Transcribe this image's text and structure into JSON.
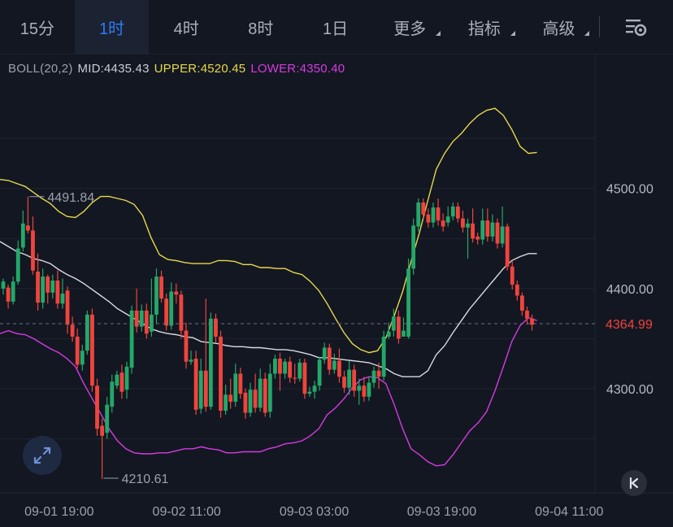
{
  "tabs": [
    {
      "label": "15分",
      "active": false,
      "caret": false
    },
    {
      "label": "1时",
      "active": true,
      "caret": false
    },
    {
      "label": "4时",
      "active": false,
      "caret": false
    },
    {
      "label": "8时",
      "active": false,
      "caret": false
    },
    {
      "label": "1日",
      "active": false,
      "caret": false
    },
    {
      "label": "更多",
      "active": false,
      "caret": true
    },
    {
      "label": "指标",
      "active": false,
      "caret": true
    },
    {
      "label": "高级",
      "active": false,
      "caret": true
    }
  ],
  "icons": {
    "settings": "chart-settings-icon",
    "zoom": "expand-arrows-icon",
    "reset": "scroll-to-latest-icon"
  },
  "legend": {
    "name": "BOLL(20,2)",
    "mid": "MID:4435.43",
    "upper": "UPPER:4520.45",
    "lower": "LOWER:4350.40"
  },
  "colors": {
    "up": "#24a869",
    "down": "#f0443d",
    "mid": "#d9dbe0",
    "upper": "#e7d94a",
    "lower": "#d63be0",
    "active_tab": "#2f7bf2"
  },
  "chart_data": {
    "type": "candlestick",
    "y_ticks": [
      "4500.00",
      "4400.00",
      "4300.00"
    ],
    "x_ticks": [
      "09-01 19:00",
      "09-02 11:00",
      "09-03 03:00",
      "09-03 19:00",
      "09-04 11:00"
    ],
    "current_price": "4364.99",
    "high_label": "4491.84",
    "low_label": "4210.61",
    "ylim": [
      4196,
      4607
    ],
    "candles": [
      [
        4400,
        4407,
        4394,
        4410
      ],
      [
        4401,
        4387,
        4380,
        4404
      ],
      [
        4387,
        4407,
        4384,
        4412
      ],
      [
        4407,
        4440,
        4404,
        4448
      ],
      [
        4441,
        4465,
        4437,
        4478
      ],
      [
        4463,
        4458,
        4455,
        4492
      ],
      [
        4458,
        4418,
        4414,
        4472
      ],
      [
        4417,
        4386,
        4378,
        4435
      ],
      [
        4386,
        4412,
        4380,
        4420
      ],
      [
        4412,
        4396,
        4385,
        4414
      ],
      [
        4396,
        4408,
        4390,
        4414
      ],
      [
        4408,
        4385,
        4380,
        4418
      ],
      [
        4385,
        4395,
        4380,
        4410
      ],
      [
        4398,
        4364,
        4355,
        4402
      ],
      [
        4364,
        4352,
        4347,
        4372
      ],
      [
        4352,
        4324,
        4320,
        4360
      ],
      [
        4324,
        4338,
        4318,
        4344
      ],
      [
        4338,
        4374,
        4334,
        4378
      ],
      [
        4374,
        4303,
        4297,
        4380
      ],
      [
        4303,
        4260,
        4253,
        4310
      ],
      [
        4263,
        4253,
        4210,
        4270
      ],
      [
        4256,
        4284,
        4250,
        4292
      ],
      [
        4282,
        4307,
        4276,
        4314
      ],
      [
        4303,
        4314,
        4300,
        4318
      ],
      [
        4316,
        4297,
        4290,
        4324
      ],
      [
        4299,
        4322,
        4290,
        4327
      ],
      [
        4321,
        4378,
        4315,
        4383
      ],
      [
        4378,
        4362,
        4356,
        4400
      ],
      [
        4362,
        4378,
        4357,
        4384
      ],
      [
        4378,
        4355,
        4350,
        4385
      ],
      [
        4357,
        4374,
        4352,
        4410
      ],
      [
        4374,
        4412,
        4365,
        4420
      ],
      [
        4412,
        4390,
        4386,
        4418
      ],
      [
        4390,
        4363,
        4358,
        4395
      ],
      [
        4363,
        4397,
        4359,
        4406
      ],
      [
        4397,
        4394,
        4385,
        4405
      ],
      [
        4394,
        4358,
        4350,
        4398
      ],
      [
        4358,
        4327,
        4320,
        4366
      ],
      [
        4327,
        4329,
        4324,
        4338
      ],
      [
        4330,
        4279,
        4274,
        4338
      ],
      [
        4280,
        4318,
        4275,
        4330
      ],
      [
        4318,
        4282,
        4277,
        4390
      ],
      [
        4282,
        4370,
        4279,
        4376
      ],
      [
        4370,
        4352,
        4346,
        4375
      ],
      [
        4352,
        4278,
        4271,
        4358
      ],
      [
        4278,
        4294,
        4274,
        4304
      ],
      [
        4294,
        4287,
        4280,
        4310
      ],
      [
        4287,
        4315,
        4282,
        4325
      ],
      [
        4315,
        4295,
        4290,
        4321
      ],
      [
        4296,
        4276,
        4270,
        4300
      ],
      [
        4276,
        4299,
        4272,
        4306
      ],
      [
        4299,
        4281,
        4276,
        4315
      ],
      [
        4281,
        4310,
        4277,
        4320
      ],
      [
        4310,
        4276,
        4272,
        4316
      ],
      [
        4277,
        4315,
        4271,
        4325
      ],
      [
        4315,
        4330,
        4310,
        4334
      ],
      [
        4330,
        4315,
        4298,
        4336
      ],
      [
        4315,
        4327,
        4310,
        4330
      ],
      [
        4327,
        4311,
        4306,
        4332
      ],
      [
        4311,
        4310,
        4305,
        4325
      ],
      [
        4310,
        4326,
        4307,
        4330
      ],
      [
        4326,
        4295,
        4290,
        4330
      ],
      [
        4295,
        4297,
        4292,
        4302
      ],
      [
        4297,
        4303,
        4290,
        4308
      ],
      [
        4303,
        4329,
        4298,
        4332
      ],
      [
        4329,
        4341,
        4325,
        4346
      ],
      [
        4341,
        4319,
        4314,
        4345
      ],
      [
        4319,
        4328,
        4315,
        4335
      ],
      [
        4328,
        4312,
        4306,
        4340
      ],
      [
        4312,
        4301,
        4296,
        4318
      ],
      [
        4301,
        4319,
        4294,
        4328
      ],
      [
        4319,
        4298,
        4292,
        4324
      ],
      [
        4298,
        4303,
        4284,
        4310
      ],
      [
        4303,
        4292,
        4287,
        4312
      ],
      [
        4292,
        4306,
        4288,
        4312
      ],
      [
        4306,
        4318,
        4301,
        4322
      ],
      [
        4318,
        4312,
        4300,
        4326
      ],
      [
        4312,
        4352,
        4308,
        4358
      ],
      [
        4352,
        4357,
        4350,
        4366
      ],
      [
        4358,
        4372,
        4352,
        4380
      ],
      [
        4372,
        4350,
        4345,
        4378
      ],
      [
        4352,
        4358,
        4355,
        4371
      ],
      [
        4352,
        4420,
        4350,
        4430
      ],
      [
        4420,
        4463,
        4414,
        4470
      ],
      [
        4462,
        4486,
        4457,
        4490
      ],
      [
        4486,
        4474,
        4470,
        4490
      ],
      [
        4474,
        4466,
        4461,
        4480
      ],
      [
        4466,
        4481,
        4461,
        4486
      ],
      [
        4481,
        4468,
        4463,
        4490
      ],
      [
        4468,
        4462,
        4457,
        4475
      ],
      [
        4466,
        4472,
        4462,
        4482
      ],
      [
        4472,
        4482,
        4468,
        4486
      ],
      [
        4482,
        4470,
        4466,
        4486
      ],
      [
        4470,
        4461,
        4456,
        4478
      ],
      [
        4461,
        4465,
        4430,
        4470
      ],
      [
        4465,
        4450,
        4446,
        4480
      ],
      [
        4452,
        4449,
        4444,
        4456
      ],
      [
        4449,
        4468,
        4444,
        4480
      ],
      [
        4468,
        4452,
        4447,
        4480
      ],
      [
        4452,
        4466,
        4447,
        4474
      ],
      [
        4466,
        4445,
        4440,
        4470
      ],
      [
        4445,
        4462,
        4441,
        4482
      ],
      [
        4462,
        4422,
        4418,
        4465
      ],
      [
        4422,
        4404,
        4399,
        4428
      ],
      [
        4404,
        4393,
        4388,
        4408
      ],
      [
        4393,
        4378,
        4373,
        4396
      ],
      [
        4378,
        4370,
        4364,
        4382
      ],
      [
        4370,
        4364,
        4358,
        4374
      ]
    ],
    "mid": [
      4447,
      4442,
      4437,
      4434,
      4430,
      4428,
      4425,
      4419,
      4414,
      4410,
      4405,
      4399,
      4393,
      4387,
      4380,
      4375,
      4370,
      4365,
      4360,
      4357,
      4355,
      4354,
      4352,
      4351,
      4347,
      4346,
      4345,
      4343,
      4342,
      4342,
      4341,
      4341,
      4340,
      4339,
      4339,
      4338,
      4336,
      4334,
      4331,
      4331,
      4330,
      4329,
      4328,
      4327,
      4326,
      4323,
      4320,
      4315,
      4312,
      4312,
      4312,
      4318,
      4334,
      4343,
      4356,
      4368,
      4380,
      4390,
      4400,
      4410,
      4420,
      4428,
      4432,
      4435,
      4435
    ],
    "upper": [
      4509,
      4508,
      4505,
      4502,
      4496,
      4490,
      4485,
      4477,
      4472,
      4471,
      4477,
      4486,
      4492,
      4492,
      4490,
      4488,
      4484,
      4473,
      4451,
      4434,
      4429,
      4428,
      4426,
      4425,
      4425,
      4425,
      4428,
      4428,
      4427,
      4424,
      4424,
      4421,
      4421,
      4420,
      4420,
      4416,
      4414,
      4407,
      4398,
      4385,
      4370,
      4356,
      4345,
      4339,
      4336,
      4338,
      4351,
      4373,
      4397,
      4427,
      4456,
      4488,
      4519,
      4535,
      4547,
      4555,
      4565,
      4573,
      4578,
      4580,
      4573,
      4559,
      4542,
      4535,
      4536
    ],
    "lower": [
      4355,
      4358,
      4355,
      4354,
      4350,
      4345,
      4340,
      4336,
      4330,
      4322,
      4305,
      4290,
      4275,
      4260,
      4248,
      4240,
      4236,
      4235,
      4235,
      4236,
      4236,
      4238,
      4240,
      4240,
      4242,
      4240,
      4239,
      4236,
      4236,
      4237,
      4237,
      4237,
      4240,
      4242,
      4245,
      4246,
      4248,
      4253,
      4260,
      4274,
      4281,
      4290,
      4301,
      4309,
      4312,
      4311,
      4305,
      4284,
      4260,
      4240,
      4234,
      4227,
      4223,
      4224,
      4234,
      4246,
      4258,
      4266,
      4277,
      4298,
      4322,
      4347,
      4363,
      4371,
      4368
    ]
  }
}
